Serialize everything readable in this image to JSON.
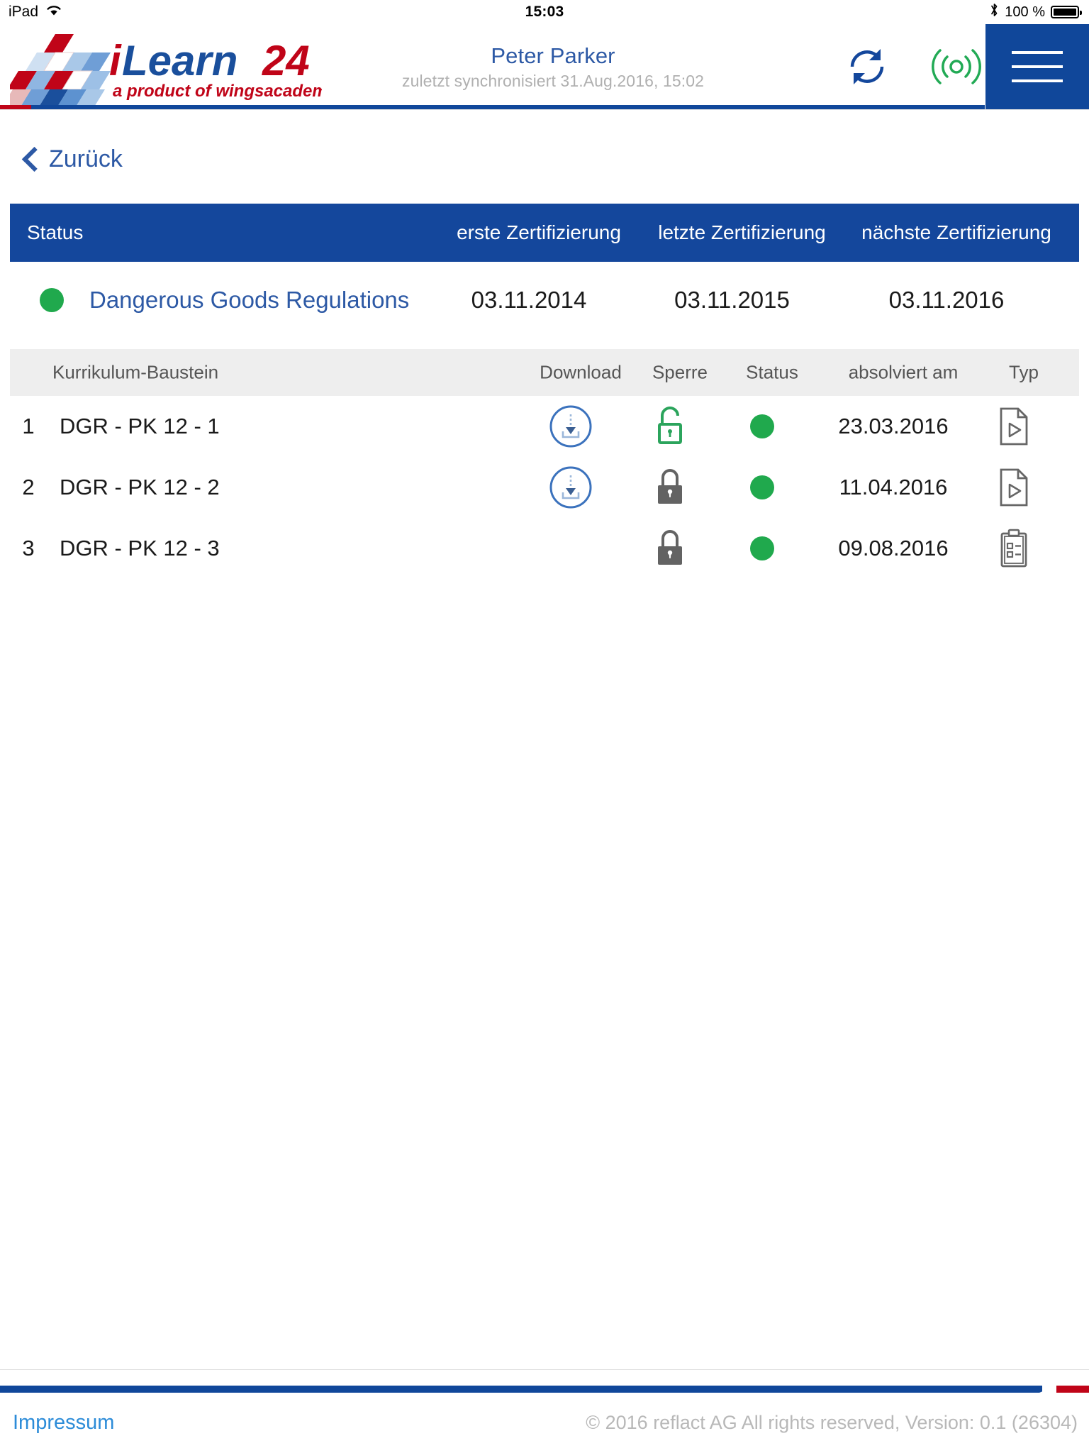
{
  "statusbar": {
    "device": "iPad",
    "wifi_icon": "wifi-icon",
    "time": "15:03",
    "bluetooth_icon": "bluetooth-icon",
    "battery_label": "100 %",
    "battery_percent": 100
  },
  "header": {
    "logo": {
      "name": "iLearn24",
      "word_i": "i",
      "word_learn": "Learn",
      "word_24": "24",
      "tagline": "a product of wingsacademy"
    },
    "user": "Peter Parker",
    "sync_status": "zuletzt synchronisiert 31.Aug.2016, 15:02",
    "sync_icon": "sync-refresh-icon",
    "broadcast_icon": "online-broadcast-icon",
    "menu_icon": "hamburger-menu-icon",
    "accent_blue": "#10479a",
    "accent_red": "#c00418"
  },
  "back": {
    "label": "Zurück",
    "icon": "chevron-left-icon"
  },
  "cert_table": {
    "headers": {
      "status": "Status",
      "first": "erste Zertifizierung",
      "last": "letzte Zertifizierung",
      "next": "nächste Zertifizierung"
    },
    "row": {
      "status_dot": "green",
      "title": "Dangerous Goods Regulations",
      "first": "03.11.2014",
      "last": "03.11.2015",
      "next": "03.11.2016"
    },
    "header_bg": "#14479c",
    "green": "#20a94d"
  },
  "module_table": {
    "headers": {
      "name": "Kurrikulum-Baustein",
      "download": "Download",
      "lock": "Sperre",
      "status": "Status",
      "completed": "absolviert am",
      "type": "Typ"
    },
    "rows": [
      {
        "index": "1",
        "name": "DGR - PK 12 - 1",
        "download": "download-circle-icon",
        "lock": "unlocked-padlock-icon",
        "lock_state": "unlocked",
        "status_dot": "green",
        "completed": "23.03.2016",
        "type_icon": "document-play-icon"
      },
      {
        "index": "2",
        "name": "DGR - PK 12 - 2",
        "download": "download-circle-icon",
        "lock": "locked-padlock-icon",
        "lock_state": "locked",
        "status_dot": "green",
        "completed": "11.04.2016",
        "type_icon": "document-play-icon"
      },
      {
        "index": "3",
        "name": "DGR - PK 12 - 3",
        "download": "",
        "lock": "locked-padlock-icon",
        "lock_state": "locked",
        "status_dot": "green",
        "completed": "09.08.2016",
        "type_icon": "clipboard-quiz-icon"
      }
    ]
  },
  "footer": {
    "impressum": "Impressum",
    "copyright": "© 2016 reflact AG All rights reserved, Version:  0.1 (26304)"
  }
}
